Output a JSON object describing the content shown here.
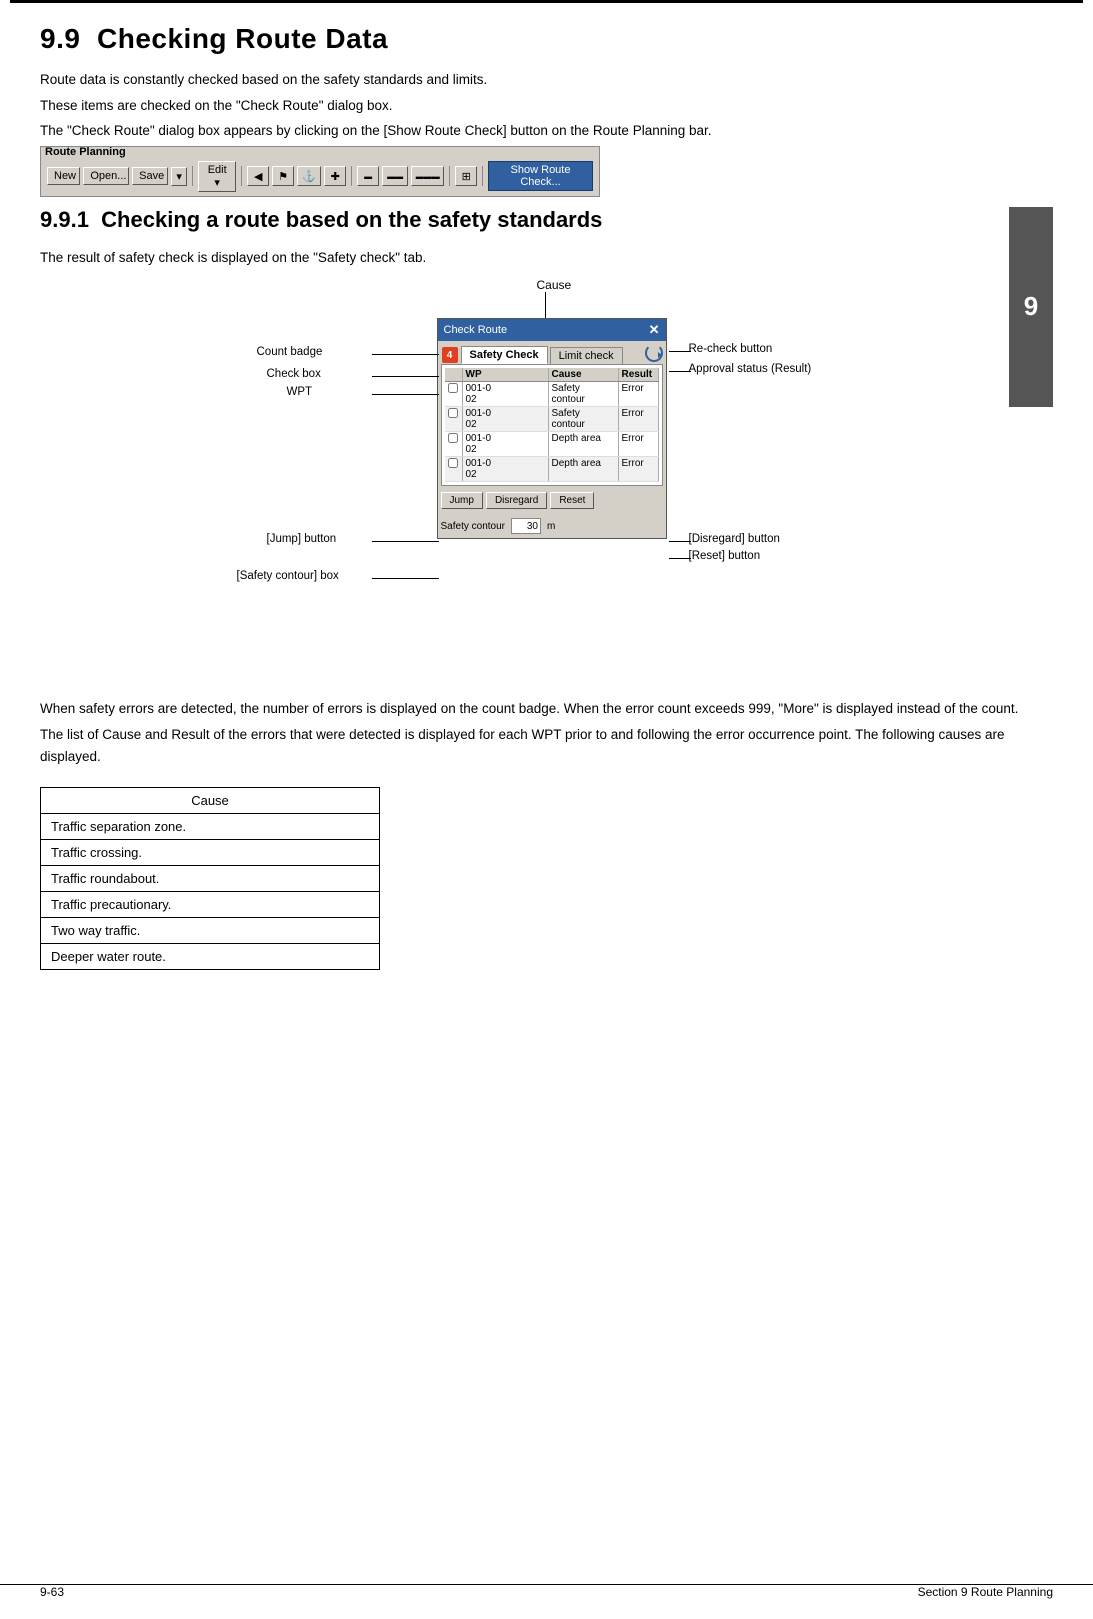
{
  "page": {
    "top_border": true,
    "section": "9.9",
    "section_title": "Checking Route Data",
    "intro_lines": [
      "Route data is constantly checked based on the safety standards and limits.",
      "These items are checked on the \"Check Route\" dialog box.",
      "The \"Check Route\" dialog box appears by clicking on the [Show Route Check] button on the Route Planning bar."
    ],
    "route_bar": {
      "title": "Route Planning",
      "buttons": [
        {
          "label": "New",
          "type": "normal"
        },
        {
          "label": "Open...",
          "type": "normal"
        },
        {
          "label": "Save",
          "type": "normal"
        },
        {
          "label": "▾",
          "type": "small"
        },
        {
          "label": "Edit ▾",
          "type": "normal"
        },
        {
          "label": "◀",
          "type": "icon"
        },
        {
          "label": "⚑",
          "type": "icon"
        },
        {
          "label": "⚓",
          "type": "icon"
        },
        {
          "label": "✚",
          "type": "icon"
        },
        {
          "label": "▬",
          "type": "icon"
        },
        {
          "label": "▬▬",
          "type": "icon"
        },
        {
          "label": "▬▬▬",
          "type": "icon"
        },
        {
          "label": "⊞",
          "type": "icon"
        },
        {
          "label": "Show Route Check...",
          "type": "highlight"
        }
      ]
    },
    "subsection": "9.9.1",
    "subsection_title": "Checking a route based on the safety standards",
    "section_badge": "9",
    "subsection_intro": "The result of safety check is displayed on the \"Safety check\" tab.",
    "diagram": {
      "cause_label": "Cause",
      "annotations": [
        {
          "id": "count_badge",
          "label": "Count badge"
        },
        {
          "id": "check_box",
          "label": "Check box"
        },
        {
          "id": "wpt",
          "label": "WPT"
        },
        {
          "id": "jump_button",
          "label": "[Jump] button"
        },
        {
          "id": "safety_contour_box",
          "label": "[Safety contour] box"
        },
        {
          "id": "recheck_button",
          "label": "Re-check button"
        },
        {
          "id": "approval_status",
          "label": "Approval status (Result)"
        },
        {
          "id": "disregard_button",
          "label": "[Disregard] button"
        },
        {
          "id": "reset_button",
          "label": "[Reset] button"
        }
      ],
      "dialog": {
        "title": "Check Route",
        "close_label": "✕",
        "tab_safety": "Safety Check",
        "tab_limit": "Limit check",
        "count_badge_value": "4",
        "table_headers": [
          "",
          "WP",
          "Cause",
          "Result"
        ],
        "rows": [
          {
            "checked": false,
            "wp": "001-0\n02",
            "cause": "Safety contour",
            "result": "Error"
          },
          {
            "checked": false,
            "wp": "001-0\n02",
            "cause": "Safety contour",
            "result": "Error"
          },
          {
            "checked": false,
            "wp": "001-0\n02",
            "cause": "Depth area",
            "result": "Error"
          },
          {
            "checked": false,
            "wp": "001-0\n02",
            "cause": "Depth area",
            "result": "Error"
          }
        ],
        "footer_buttons": [
          "Jump",
          "Disregard",
          "Reset"
        ],
        "safety_contour_label": "Safety contour",
        "safety_contour_value": "30",
        "safety_contour_unit": "m"
      }
    },
    "body_paragraphs": [
      "When safety errors are detected, the number of errors is displayed on the count badge. When the error count exceeds 999, \"More\" is displayed instead of the count.",
      "  The list of Cause and Result of the errors that were detected is displayed for each WPT prior to and following the error occurrence point. The following causes are displayed."
    ],
    "cause_table": {
      "header": "Cause",
      "rows": [
        "Traffic separation zone.",
        "Traffic crossing.",
        "Traffic roundabout.",
        "Traffic precautionary.",
        "Two way traffic.",
        "Deeper water route."
      ]
    },
    "footer": {
      "left": "9-63",
      "right": "Section 9    Route Planning"
    }
  }
}
